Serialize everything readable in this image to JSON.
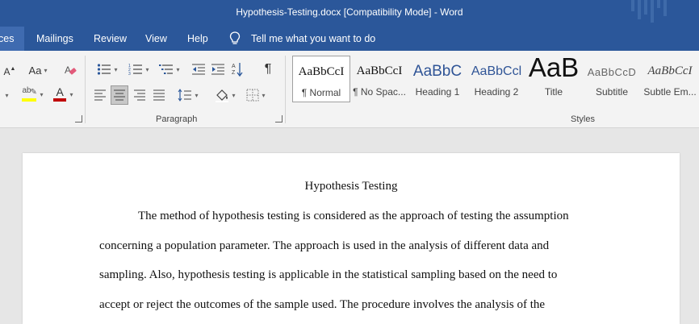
{
  "window": {
    "title": "Hypothesis-Testing.docx [Compatibility Mode]  -  Word"
  },
  "tabs": [
    {
      "label": "ces"
    },
    {
      "label": "Mailings"
    },
    {
      "label": "Review"
    },
    {
      "label": "View"
    },
    {
      "label": "Help"
    }
  ],
  "tell_me": {
    "label": "Tell me what you want to do",
    "icon": "lightbulb-icon"
  },
  "ribbon": {
    "font_group": {
      "grow_font_label": "A",
      "change_case_label": "Aa",
      "font_color_label": "A",
      "highlight_label": "ab",
      "highlight_color": "#ffff00",
      "font_color": "#c00000"
    },
    "paragraph_label": "Paragraph",
    "styles_label": "Styles",
    "styles": [
      {
        "sample": "AaBbCcI",
        "name": "¶ Normal"
      },
      {
        "sample": "AaBbCcI",
        "name": "¶ No Spac..."
      },
      {
        "sample": "AaBbC",
        "name": "Heading 1"
      },
      {
        "sample": "AaBbCcl",
        "name": "Heading 2"
      },
      {
        "sample": "AaB",
        "name": "Title"
      },
      {
        "sample": "AaBbCcD",
        "name": "Subtitle"
      },
      {
        "sample": "AaBbCcI",
        "name": "Subtle Em..."
      }
    ]
  },
  "document": {
    "title": "Hypothesis Testing",
    "lines": [
      "The method of hypothesis testing is considered as the approach of testing the assumption",
      "concerning a population parameter. The approach is used in the analysis of different data and",
      "sampling. Also, hypothesis testing is applicable in the statistical sampling based on the need to",
      "accept or reject the outcomes of the sample used. The procedure involves the analysis of the"
    ]
  }
}
